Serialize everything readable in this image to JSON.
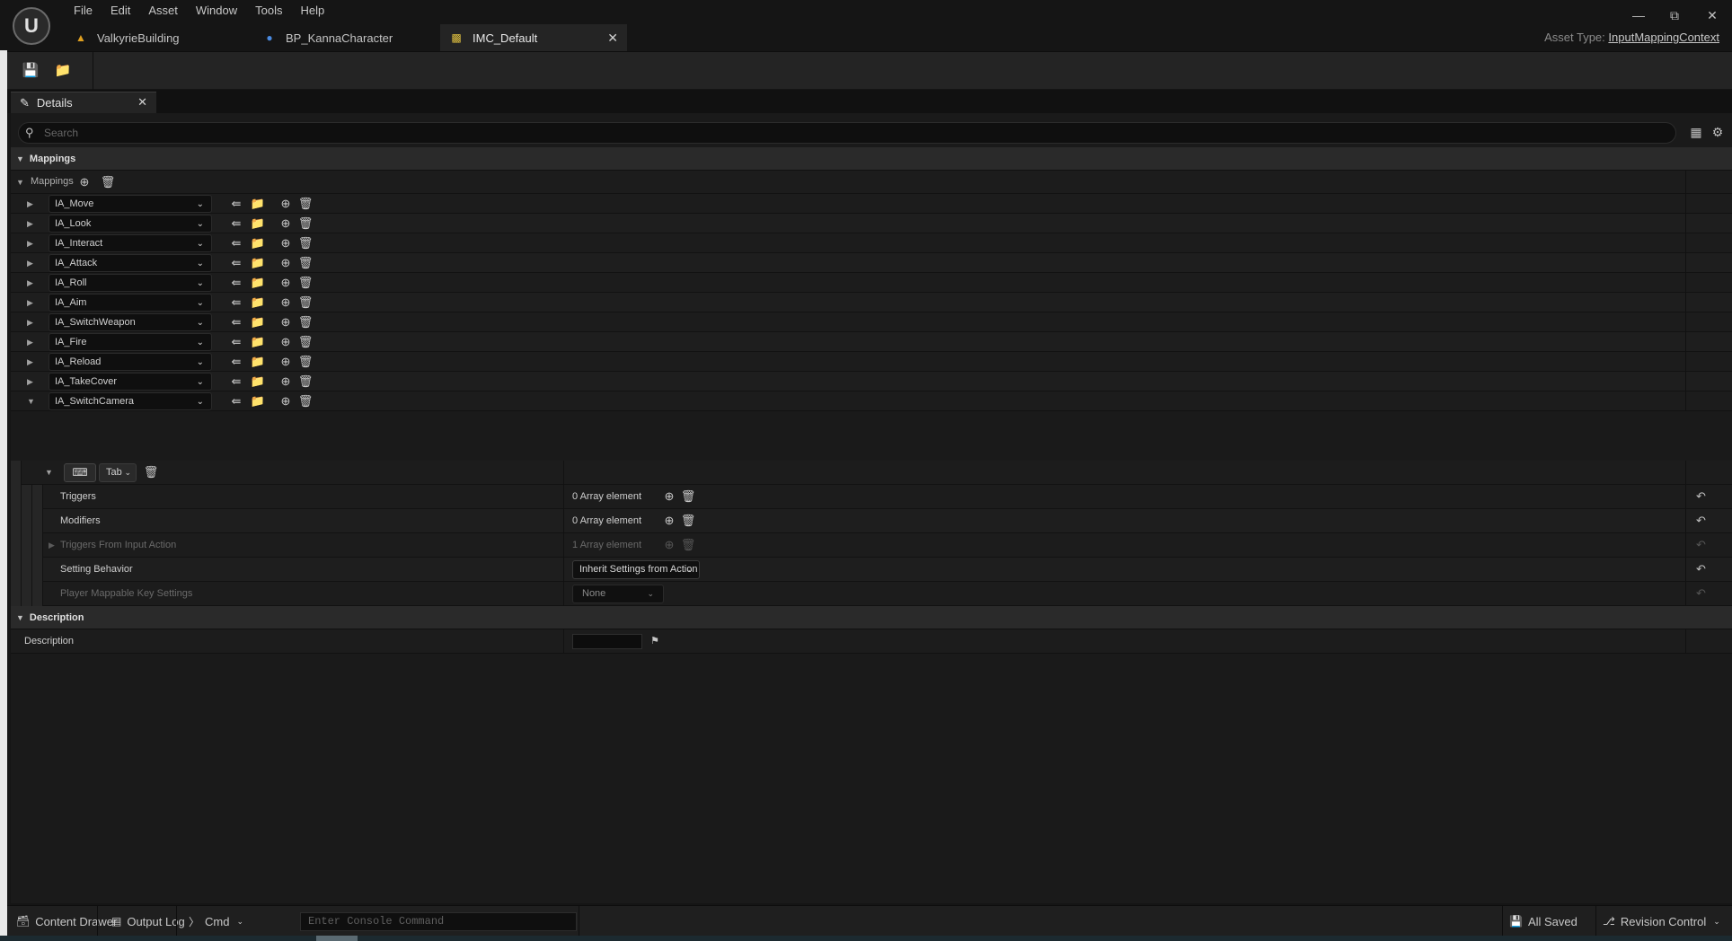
{
  "app": {
    "menu": [
      "File",
      "Edit",
      "Asset",
      "Window",
      "Tools",
      "Help"
    ],
    "tabs": [
      {
        "label": "ValkyrieBuilding",
        "icon": "level-icon"
      },
      {
        "label": "BP_KannaCharacter",
        "icon": "character-icon"
      },
      {
        "label": "IMC_Default",
        "icon": "input-mapping-icon"
      }
    ],
    "asset_type_label": "Asset Type:",
    "asset_type_value": "InputMappingContext"
  },
  "details": {
    "tab_label": "Details",
    "search_placeholder": "Search",
    "section_mappings": "Mappings",
    "mappings_label": "Mappings",
    "actions": [
      "IA_Move",
      "IA_Look",
      "IA_Interact",
      "IA_Attack",
      "IA_Roll",
      "IA_Aim",
      "IA_SwitchWeapon",
      "IA_Fire",
      "IA_Reload",
      "IA_TakeCover",
      "IA_SwitchCamera"
    ],
    "key_value": "Tab",
    "props": {
      "triggers": {
        "label": "Triggers",
        "value": "0 Array element"
      },
      "modifiers": {
        "label": "Modifiers",
        "value": "0 Array element"
      },
      "triggers_from_action": {
        "label": "Triggers From Input Action",
        "value": "1 Array element"
      },
      "setting_behavior": {
        "label": "Setting Behavior",
        "value": "Inherit Settings from Action"
      },
      "player_mappable": {
        "label": "Player Mappable Key Settings",
        "value": "None"
      }
    },
    "section_description": "Description",
    "description_label": "Description",
    "description_value": ""
  },
  "statusbar": {
    "content_drawer": "Content Drawer",
    "output_log": "Output Log",
    "cmd": "Cmd",
    "console_placeholder": "Enter Console Command",
    "all_saved": "All Saved",
    "revision_control": "Revision Control"
  }
}
